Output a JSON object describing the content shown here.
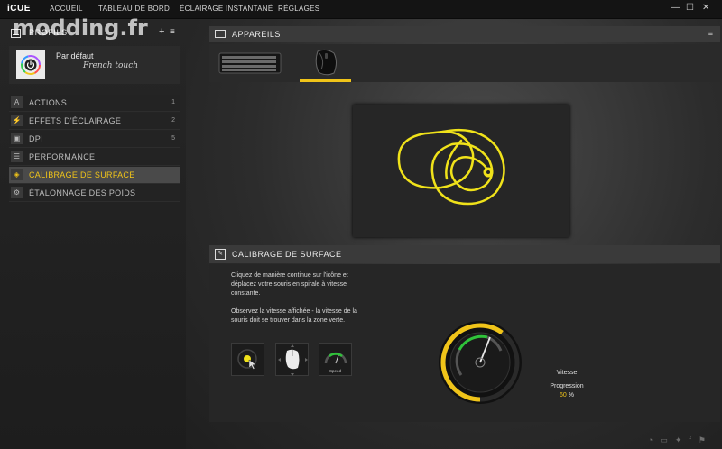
{
  "app": {
    "name": "iCUE"
  },
  "nav": {
    "items": [
      "ACCUEIL",
      "TABLEAU DE BORD",
      "ÉCLAIRAGE INSTANTANÉ",
      "RÉGLAGES"
    ]
  },
  "window_controls": {
    "minimize": "—",
    "maximize": "☐",
    "close": "✕"
  },
  "watermark": "modding.fr",
  "profiles": {
    "title": "PROFILS",
    "add": "+",
    "menu": "≡",
    "current": {
      "name": "Par défaut",
      "subtitle": "French touch"
    }
  },
  "menu": {
    "items": [
      {
        "label": "ACTIONS",
        "count": "1",
        "icon": "A"
      },
      {
        "label": "EFFETS D'ÉCLAIRAGE",
        "count": "2",
        "icon": "⚡"
      },
      {
        "label": "DPI",
        "count": "5",
        "icon": "▣"
      },
      {
        "label": "PERFORMANCE",
        "count": "",
        "icon": "☰"
      },
      {
        "label": "CALIBRAGE DE SURFACE",
        "count": "",
        "icon": "◈"
      },
      {
        "label": "ÉTALONNAGE DES POIDS",
        "count": "",
        "icon": "⚙"
      }
    ]
  },
  "devices": {
    "title": "APPAREILS",
    "menu": "≡"
  },
  "calibration": {
    "title": "CALIBRAGE DE SURFACE",
    "instructions_1": "Cliquez de manière continue sur l'icône et déplacez votre souris en spirale à vitesse constante.",
    "instructions_2": "Observez la vitesse affichée - la vitesse de la souris doit se trouver dans la zone verte.",
    "speed_tile_label": "Speed",
    "gauge": {
      "speed_label": "Vitesse",
      "progress_label": "Progression",
      "progress_value": "60",
      "progress_unit": "%",
      "progress_fraction": 0.6
    }
  },
  "colors": {
    "accent": "#f0c419",
    "green": "#2fc23a"
  }
}
